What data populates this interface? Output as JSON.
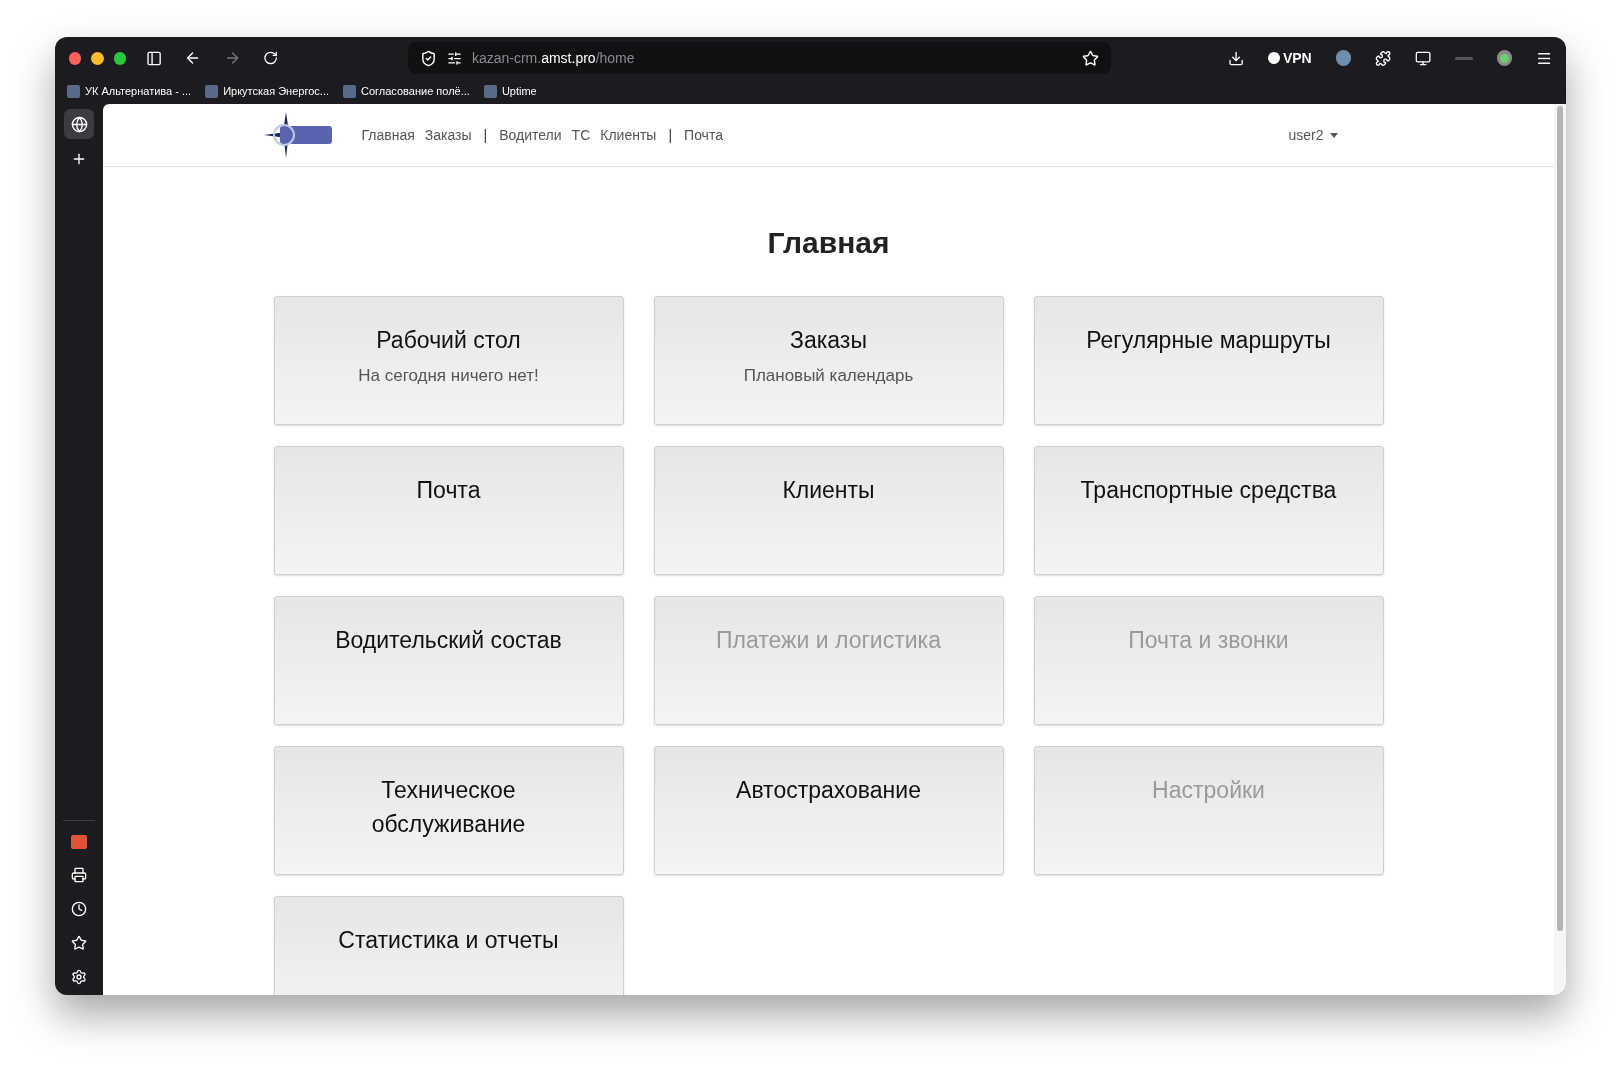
{
  "browser": {
    "url_host_prefix": "kazan-crm.",
    "url_host": "amst.pro",
    "url_path": "/home",
    "vpn_label": "VPN",
    "bookmarks": [
      {
        "label": "УК Альтернатива - ..."
      },
      {
        "label": "Иркутская Энергос..."
      },
      {
        "label": "Согласование полё..."
      },
      {
        "label": "Uptime"
      }
    ]
  },
  "navbar": {
    "links": [
      {
        "label": "Главная",
        "kind": "link"
      },
      {
        "label": "Заказы",
        "kind": "link"
      },
      {
        "label": "|",
        "kind": "separator"
      },
      {
        "label": "Водители",
        "kind": "link"
      },
      {
        "label": "ТС",
        "kind": "link"
      },
      {
        "label": "Клиенты",
        "kind": "link"
      },
      {
        "label": "|",
        "kind": "separator"
      },
      {
        "label": "Почта",
        "kind": "link"
      }
    ],
    "user": "user2"
  },
  "page_title": "Главная",
  "tiles": [
    {
      "title": "Рабочий стол",
      "subtitle": "На сегодня ничего нет!",
      "disabled": false
    },
    {
      "title": "Заказы",
      "subtitle": "Плановый календарь",
      "disabled": false
    },
    {
      "title": "Регулярные маршруты",
      "disabled": false
    },
    {
      "title": "Почта",
      "disabled": false
    },
    {
      "title": "Клиенты",
      "disabled": false
    },
    {
      "title": "Транспортные средства",
      "disabled": false
    },
    {
      "title": "Водительский состав",
      "disabled": false
    },
    {
      "title": "Платежи и логистика",
      "disabled": true
    },
    {
      "title": "Почта и звонки",
      "disabled": true
    },
    {
      "title": "Техническое обслуживание",
      "disabled": false
    },
    {
      "title": "Автострахование",
      "disabled": false
    },
    {
      "title": "Настройки",
      "disabled": true
    },
    {
      "title": "Статистика и отчеты",
      "disabled": false
    }
  ]
}
